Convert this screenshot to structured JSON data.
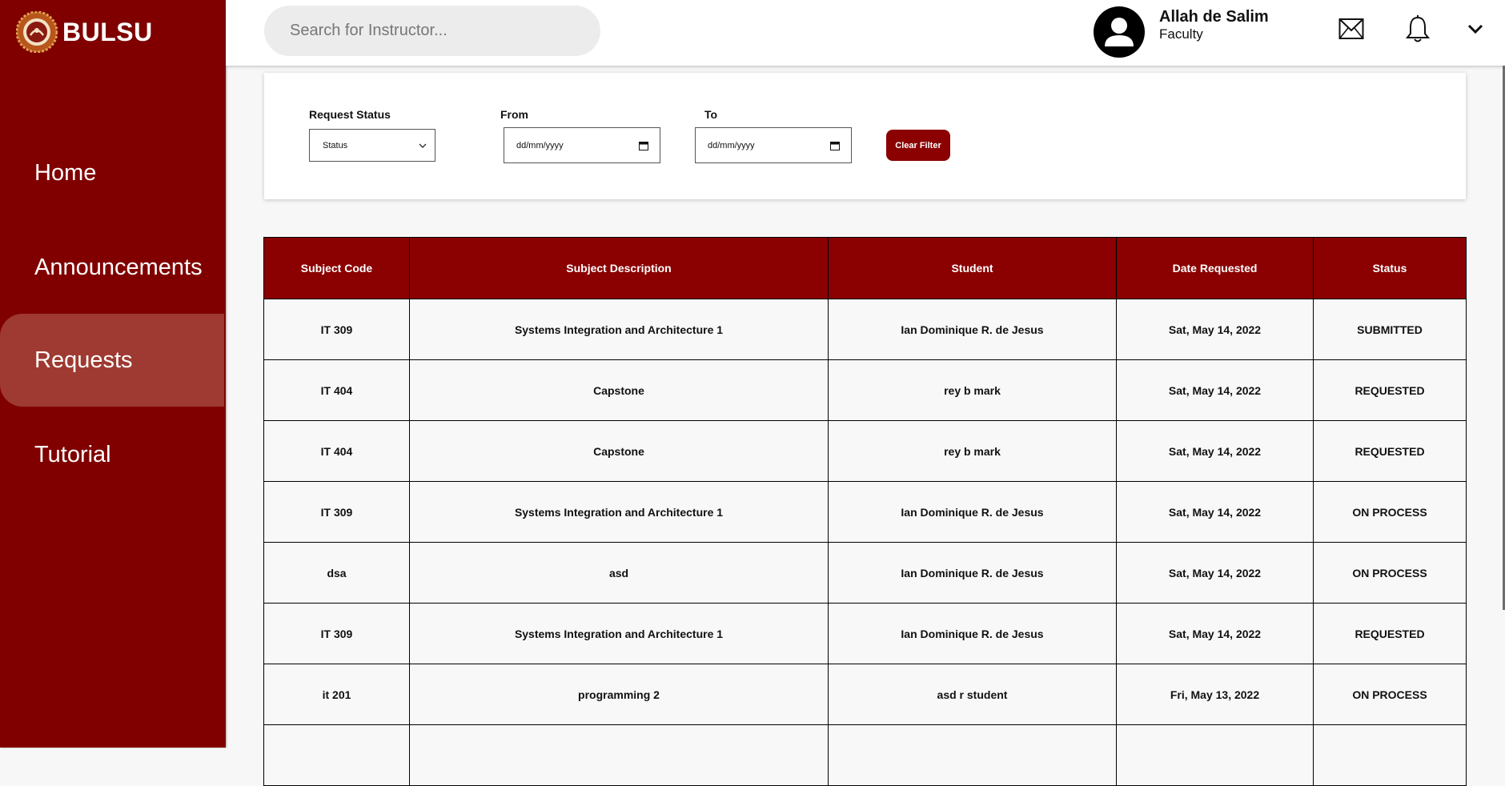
{
  "brand": {
    "name": "BULSU"
  },
  "sidebar": {
    "items": [
      {
        "label": "Home",
        "active": false
      },
      {
        "label": "Announcements",
        "active": false
      },
      {
        "label": "Requests",
        "active": true
      },
      {
        "label": "Tutorial",
        "active": false
      }
    ]
  },
  "header": {
    "search": {
      "placeholder": "Search for Instructor...",
      "value": ""
    },
    "user": {
      "name": "Allah de Salim",
      "role": "Faculty"
    },
    "icons": [
      "avatar-user-icon",
      "mail-icon",
      "bell-icon",
      "chevron-down-icon"
    ]
  },
  "filters": {
    "status": {
      "label": "Request Status",
      "value": "Status"
    },
    "from": {
      "label": "From",
      "value": "dd/mm/yyyy"
    },
    "to": {
      "label": "To",
      "value": "dd/mm/yyyy"
    },
    "clear_label": "Clear Filter"
  },
  "table": {
    "columns": [
      "Subject Code",
      "Subject Description",
      "Student",
      "Date Requested",
      "Status"
    ],
    "rows": [
      [
        "IT 309",
        "Systems Integration and Architecture 1",
        "Ian Dominique R. de Jesus",
        "Sat, May 14, 2022",
        "SUBMITTED"
      ],
      [
        "IT 404",
        "Capstone",
        "rey b mark",
        "Sat, May 14, 2022",
        "REQUESTED"
      ],
      [
        "IT 404",
        "Capstone",
        "rey b mark",
        "Sat, May 14, 2022",
        "REQUESTED"
      ],
      [
        "IT 309",
        "Systems Integration and Architecture 1",
        "Ian Dominique R. de Jesus",
        "Sat, May 14, 2022",
        "ON PROCESS"
      ],
      [
        "dsa",
        "asd",
        "Ian Dominique R. de Jesus",
        "Sat, May 14, 2022",
        "ON PROCESS"
      ],
      [
        "IT 309",
        "Systems Integration and Architecture 1",
        "Ian Dominique R. de Jesus",
        "Sat, May 14, 2022",
        "REQUESTED"
      ],
      [
        "it 201",
        "programming 2",
        "asd r student",
        "Fri, May 13, 2022",
        "ON PROCESS"
      ],
      [
        "",
        "",
        "",
        "",
        ""
      ]
    ]
  },
  "colors": {
    "primary": "#800000",
    "header_cell": "#8b0000",
    "active_nav": "#9e3a31"
  }
}
